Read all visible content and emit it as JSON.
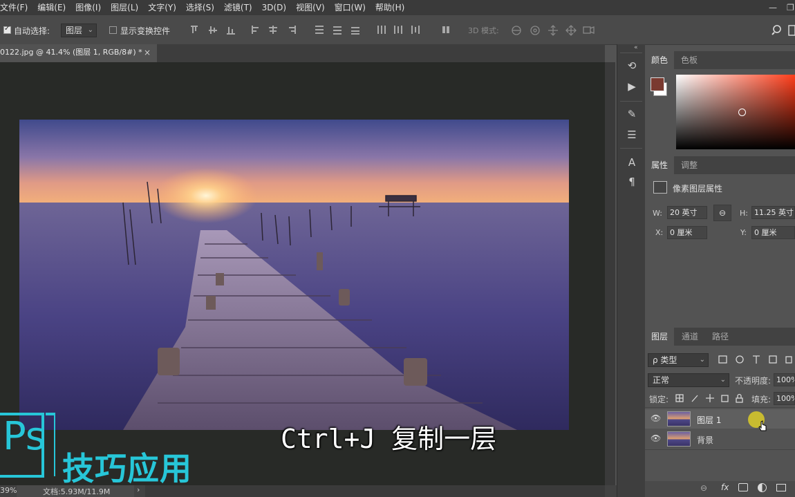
{
  "menu": [
    "文件(F)",
    "编辑(E)",
    "图像(I)",
    "图层(L)",
    "文字(Y)",
    "选择(S)",
    "滤镜(T)",
    "3D(D)",
    "视图(V)",
    "窗口(W)",
    "帮助(H)"
  ],
  "options": {
    "auto_select_label": "自动选择:",
    "auto_select_value": "图层",
    "show_transform_label": "显示变换控件",
    "mode_3d_label": "3D 模式:"
  },
  "document": {
    "tab_title": "0122.jpg @ 41.4% (图层 1, RGB/8#) *",
    "close": "×"
  },
  "status": {
    "zoom": "39%",
    "doc_size": "文档:5.93M/11.9M",
    "arrow": "›"
  },
  "panels": {
    "color": {
      "tabs": [
        "颜色",
        "色板"
      ],
      "foreground": "#7a3a30",
      "background": "#ffffff",
      "hue": "#ff3d1a"
    },
    "properties": {
      "tabs": [
        "属性",
        "调整"
      ],
      "title": "像素图层属性",
      "w_label": "W:",
      "w_value": "20 英寸",
      "h_label": "H:",
      "h_value": "11.25 英寸",
      "x_label": "X:",
      "x_value": "0 厘米",
      "y_label": "Y:",
      "y_value": "0 厘米"
    },
    "layers": {
      "tabs": [
        "图层",
        "通道",
        "路径"
      ],
      "filter_label": "ρ 类型",
      "blend_mode": "正常",
      "opacity_label": "不透明度:",
      "opacity_value": "100%",
      "lock_label": "锁定:",
      "fill_label": "填充:",
      "fill_value": "100%",
      "items": [
        {
          "name": "图层 1",
          "selected": true
        },
        {
          "name": "背景",
          "selected": false
        }
      ],
      "bottom_icons": [
        "link-icon",
        "fx-icon",
        "mask-icon",
        "adjustment-icon",
        "folder-icon"
      ]
    }
  },
  "overlay": {
    "caption": "Ctrl+J 复制一层",
    "brand_logo": "Ps",
    "brand_text": "技巧应用"
  }
}
